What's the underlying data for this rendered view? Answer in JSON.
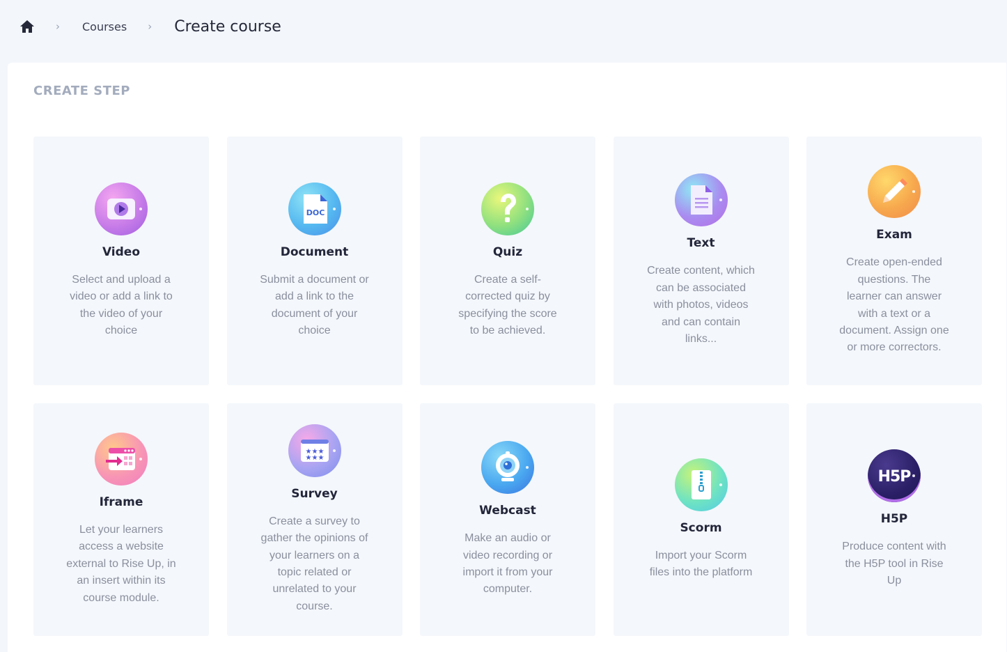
{
  "breadcrumb": {
    "home_icon": "home-icon",
    "separator": "›",
    "courses": "Courses",
    "current": "Create course"
  },
  "section": {
    "title": "CREATE STEP"
  },
  "colors": {
    "page_bg": "#f3f6fa",
    "card_bg": "#f4f7fb",
    "title": "#23263a",
    "desc": "#8a8f9e",
    "section_title": "#a3acbd"
  },
  "steps": [
    {
      "title": "Video",
      "icon": "video-icon",
      "description": "Select and upload a video or add a link to the video of your choice"
    },
    {
      "title": "Document",
      "icon": "document-icon",
      "icon_text": "DOC",
      "description": "Submit a document or add a link to the document of your choice"
    },
    {
      "title": "Quiz",
      "icon": "question-mark-icon",
      "description": "Create a self-corrected quiz by specifying the score to be achieved."
    },
    {
      "title": "Text",
      "icon": "text-file-icon",
      "description": "Create content, which can be associated with photos, videos and can contain links..."
    },
    {
      "title": "Exam",
      "icon": "pencil-icon",
      "description": "Create open-ended questions. The learner can answer with a text or a document. Assign one or more correctors."
    },
    {
      "title": "Iframe",
      "icon": "iframe-icon",
      "description": "Let your learners access a website external to Rise Up, in an insert within its course module."
    },
    {
      "title": "Survey",
      "icon": "survey-stars-icon",
      "description": "Create a survey to gather the opinions of your learners on a topic related or unrelated to your course."
    },
    {
      "title": "Webcast",
      "icon": "webcam-icon",
      "description": "Make an audio or video recording or import it from your computer."
    },
    {
      "title": "Scorm",
      "icon": "zip-file-icon",
      "description": "Import your Scorm files into the platform"
    },
    {
      "title": "H5P",
      "icon": "h5p-logo-icon",
      "icon_text": "H5P",
      "description": "Produce content with the H5P tool in Rise Up"
    }
  ]
}
